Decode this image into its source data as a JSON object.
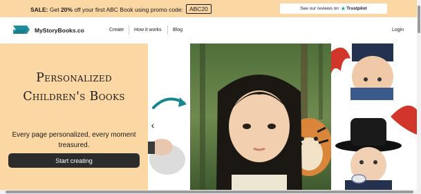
{
  "promo": {
    "label": "SALE:",
    "text_before": " Get ",
    "discount": "20%",
    "text_after": " off your first ABC Book using promo code:",
    "code": "ABC20"
  },
  "trust": {
    "text": "See our reviews on",
    "brand": "Trustpilot"
  },
  "nav": {
    "brand": "MyStoryBooks.co",
    "links": [
      "Create",
      "How it works",
      "Blog"
    ],
    "login": "Login"
  },
  "hero": {
    "title": "Personalized Children's Books",
    "subtitle": "Every page personalized, every moment treasured.",
    "cta": "Start creating"
  },
  "colors": {
    "accent": "#fbd7a3",
    "brand_teal": "#1e8e9c",
    "button_bg": "#2c2c2c"
  },
  "icons": {
    "logo": "book-logo-icon",
    "trust_star": "star-icon",
    "carousel_prev": "chevron-left-icon",
    "curved_arrow": "curved-arrow-icon"
  }
}
